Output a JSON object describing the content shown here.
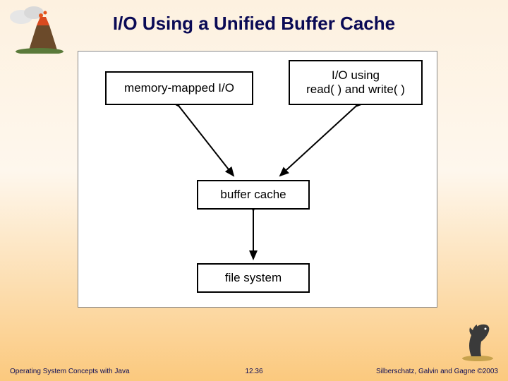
{
  "title": "I/O Using a Unified Buffer Cache",
  "boxes": {
    "mmio": "memory-mapped I/O",
    "rw": "I/O using\nread( ) and write( )",
    "bc": "buffer cache",
    "fs": "file system"
  },
  "footer": {
    "left": "Operating System Concepts with Java",
    "center": "12.36",
    "right": "Silberschatz, Galvin and Gagne ©2003"
  },
  "icons": {
    "top_left": "volcano-icon",
    "bottom_right": "dinosaur-icon"
  }
}
